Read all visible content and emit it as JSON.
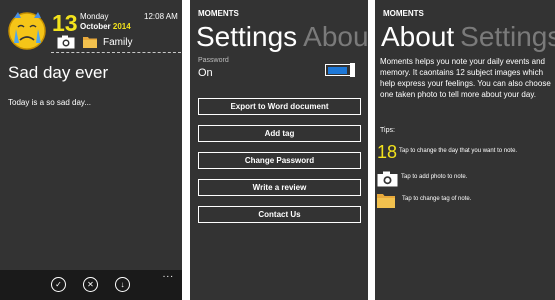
{
  "entry_screen": {
    "day_number": "13",
    "weekday": "Monday",
    "month": "October",
    "year": "2014",
    "time": "12:08 AM",
    "tag": "Family",
    "entry_title": "Sad day ever",
    "entry_body": "Today is a so sad day...",
    "appbar": {
      "more": "..."
    }
  },
  "settings_screen": {
    "app_name": "MOMENTS",
    "pivot_active": "Settings",
    "pivot_inactive": "About",
    "password_label": "Password",
    "password_value": "On",
    "password_enabled": true,
    "buttons": [
      "Export to Word document",
      "Add tag",
      "Change Password",
      "Write a review",
      "Contact Us"
    ]
  },
  "about_screen": {
    "app_name": "MOMENTS",
    "pivot_active": "About",
    "pivot_inactive": "Settings",
    "description": "Moments helps you note your daily events and memory. It caontains 12 subject images which help express  your feelings. You can also choose one taken photo to tell more about your day.",
    "tips_label": "Tips:",
    "tip_number": "18",
    "tip_day": "Tap to change the day that you want to note.",
    "tip_photo": "Tap to add photo to note.",
    "tip_tag": "Tap to change tag of note."
  },
  "colors": {
    "background": "#333333",
    "accent_yellow": "#f2e21c",
    "toggle_blue": "#1e78d7",
    "appbar": "#1a1a1a"
  },
  "icons": [
    "crying-face",
    "camera",
    "folder",
    "check",
    "close",
    "download"
  ]
}
